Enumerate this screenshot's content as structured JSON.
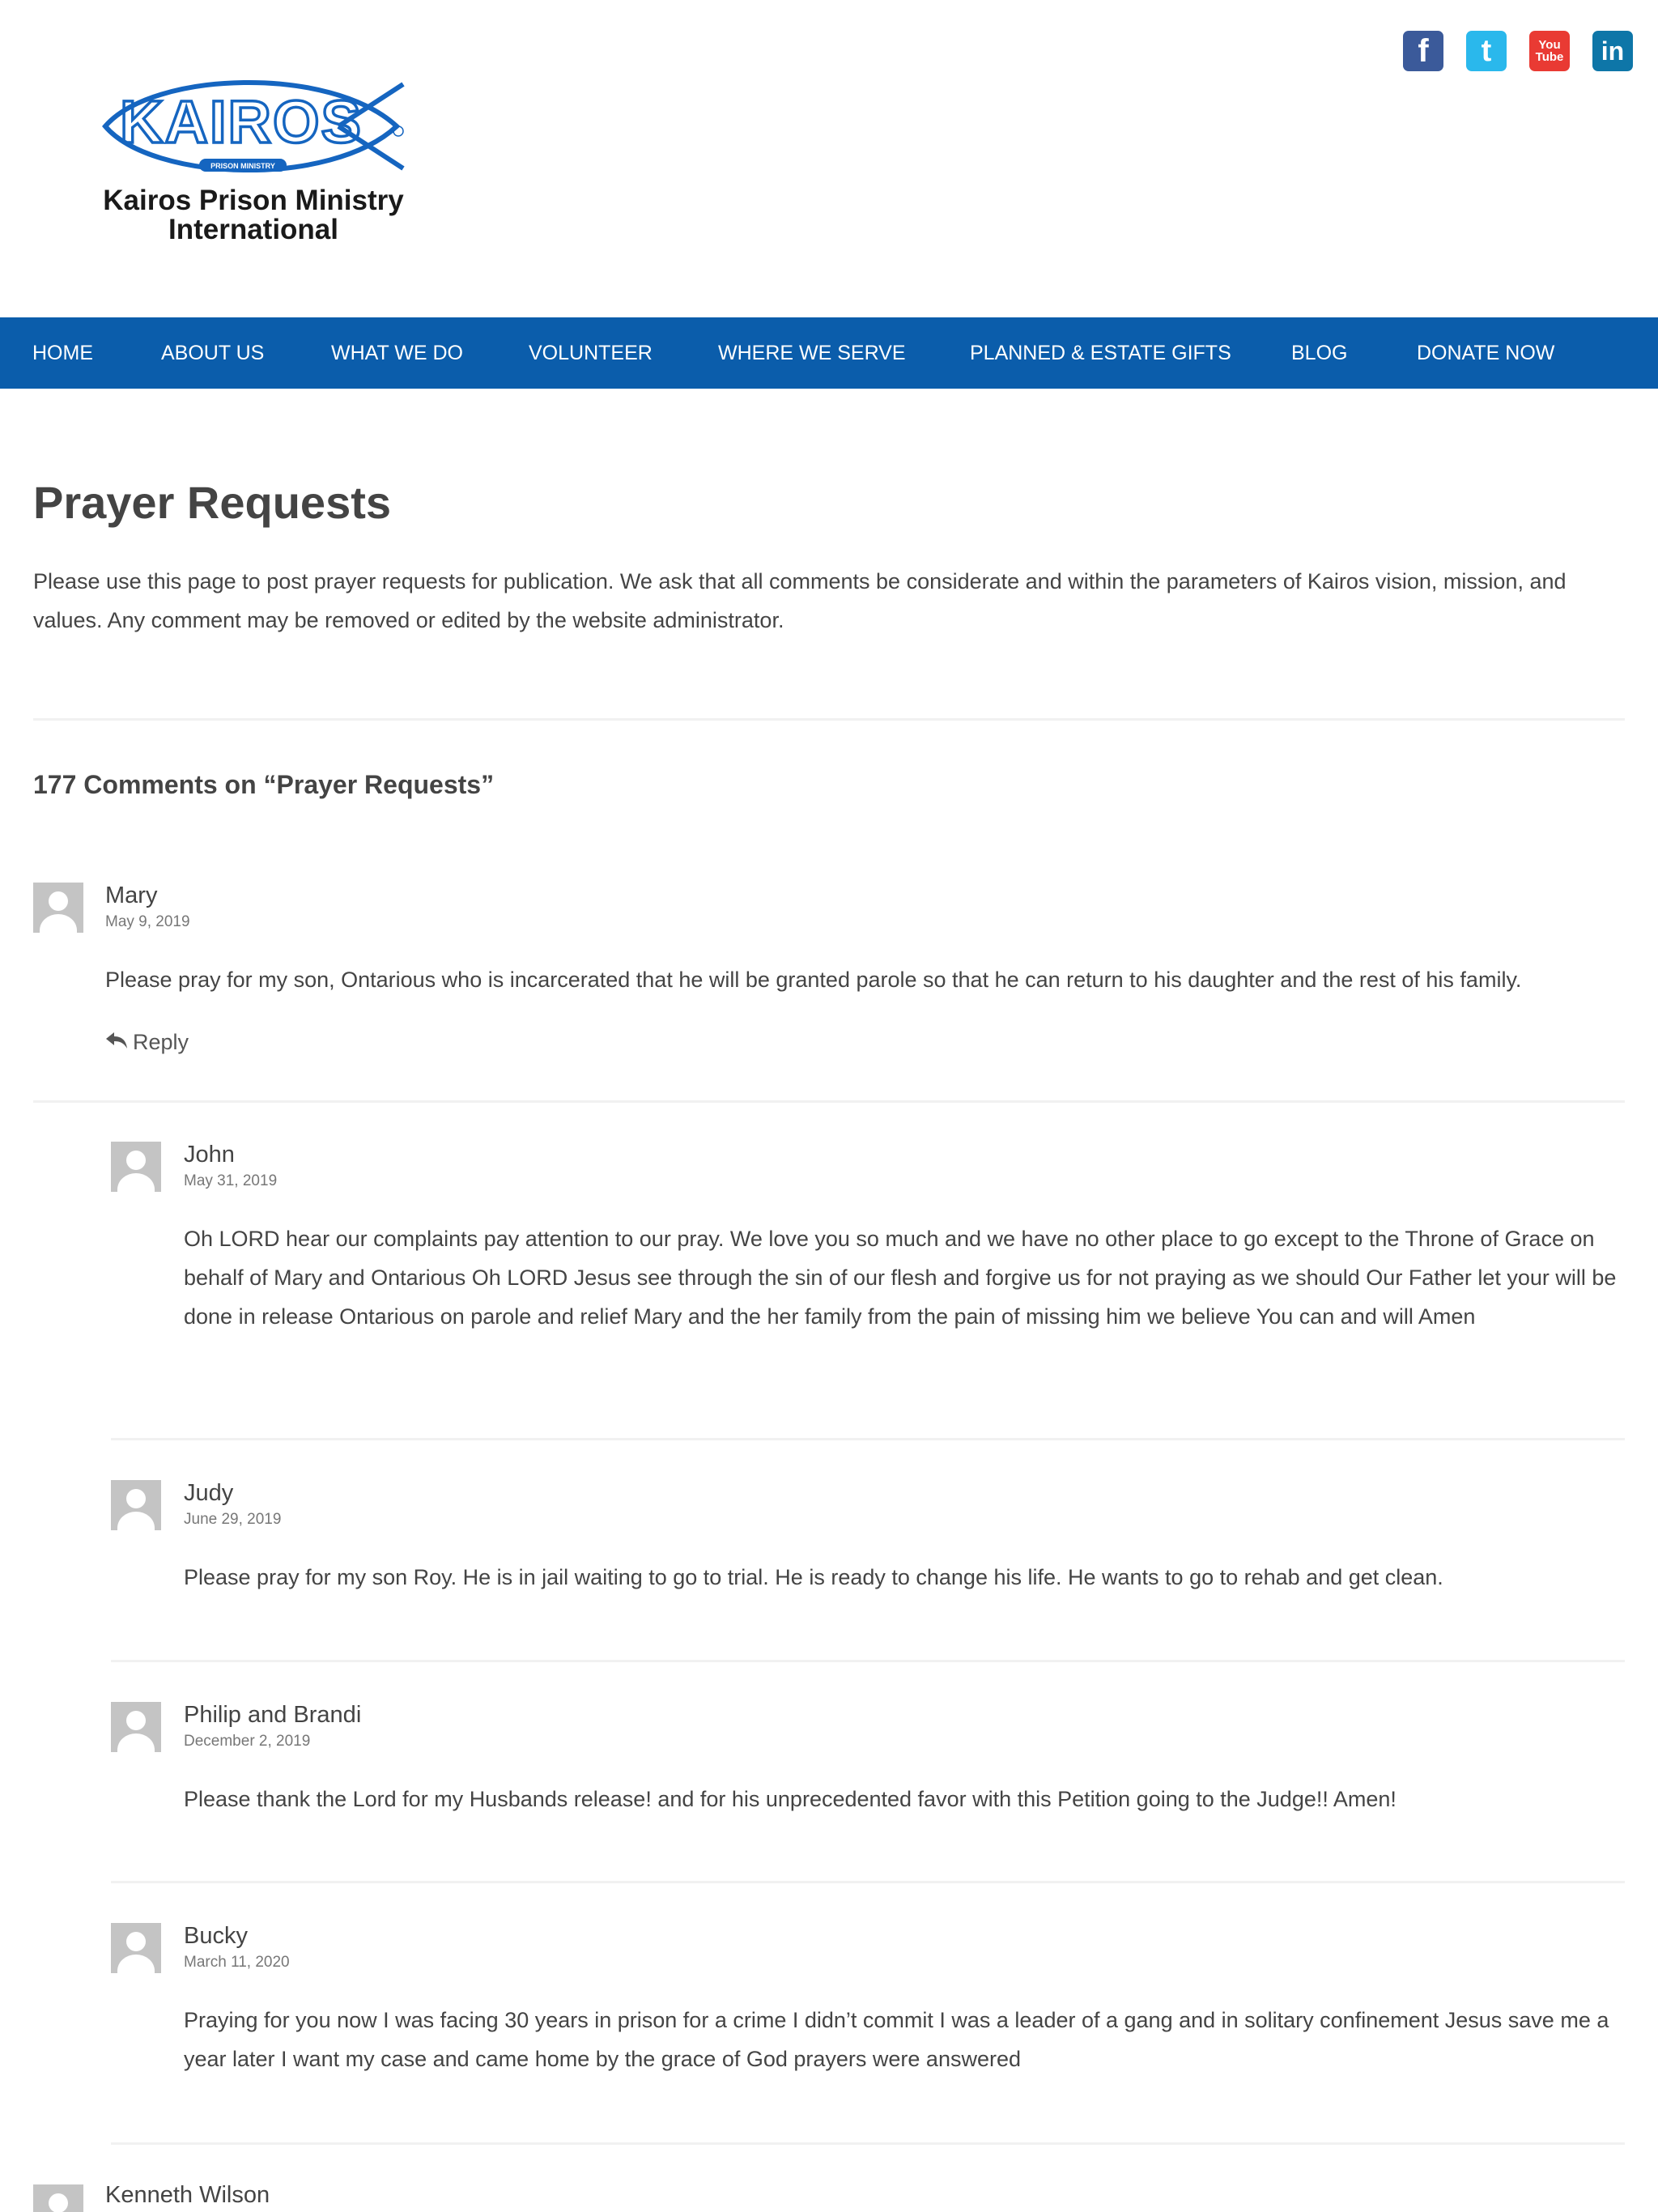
{
  "brand": {
    "logo_wordmark": "KAIROS",
    "logo_subtext": "PRISON MINISTRY",
    "name_line1": "Kairos Prison Ministry",
    "name_line2": "International",
    "brand_color": "#0b5dab"
  },
  "social": [
    {
      "name": "facebook",
      "glyph": "f",
      "color": "#3b5a9a"
    },
    {
      "name": "twitter",
      "glyph": "t",
      "color": "#2ab8ec"
    },
    {
      "name": "youtube",
      "glyph_top": "You",
      "glyph_bottom": "Tube",
      "color": "#e93a33"
    },
    {
      "name": "linkedin",
      "glyph": "in",
      "color": "#0e76a8"
    }
  ],
  "nav": [
    {
      "label": "HOME"
    },
    {
      "label": "ABOUT US"
    },
    {
      "label": "WHAT WE DO"
    },
    {
      "label": "VOLUNTEER"
    },
    {
      "label": "WHERE WE SERVE"
    },
    {
      "label": "PLANNED & ESTATE GIFTS"
    },
    {
      "label": "BLOG"
    },
    {
      "label": "DONATE NOW"
    }
  ],
  "page": {
    "title": "Prayer Requests",
    "intro": "Please use this page to post prayer requests for publication. We ask that all comments be considerate and within the parameters of Kairos vision, mission, and values. Any comment may be removed or edited by the website administrator.",
    "comments_heading": "177 Comments on “Prayer Requests”"
  },
  "comments": [
    {
      "author": "Mary",
      "date": "May 9, 2019",
      "text": "Please pray for my son, Ontarious who is incarcerated that he will be granted parole so that he can return to his daughter and the rest of his family.",
      "reply_label": "Reply"
    },
    {
      "author": "John",
      "date": "May 31, 2019",
      "text": "Oh LORD hear our complaints pay attention to our pray. We love you so much and we have no other place to go except to the Throne of Grace on behalf of Mary and Ontarious Oh LORD Jesus see through the sin of our flesh and forgive us for not praying as we should Our Father let your will be done in release Ontarious on parole and relief Mary and the her family from the pain of missing him we believe You can and will Amen"
    },
    {
      "author": "Judy",
      "date": "June 29, 2019",
      "text": "Please pray for my son Roy. He is in jail waiting to go to trial. He is ready to change his life. He wants to go to rehab and get clean."
    },
    {
      "author": "Philip and Brandi",
      "date": "December 2, 2019",
      "text": "Please thank the Lord for my Husbands release! and for his unprecedented favor with this Petition going to the Judge!! Amen!"
    },
    {
      "author": "Bucky",
      "date": "March 11, 2020",
      "text": "Praying for you now I was facing 30 years in prison for a crime I didn’t commit I was a leader of a gang and in solitary confinement Jesus save me a year later I want my case and came home by the grace of God prayers were answered"
    },
    {
      "author": "Kenneth Wilson"
    }
  ]
}
